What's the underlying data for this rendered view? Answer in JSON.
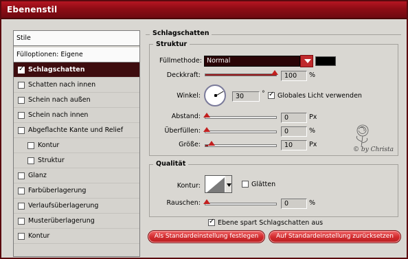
{
  "window": {
    "title": "Ebenenstil"
  },
  "left_list": {
    "items": [
      {
        "label": "Stile",
        "type": "header"
      },
      {
        "label": "Fülloptionen: Eigene",
        "type": "header"
      },
      {
        "label": "Schlagschatten",
        "checked": true,
        "selected": true
      },
      {
        "label": "Schatten nach innen",
        "checked": false
      },
      {
        "label": "Schein nach außen",
        "checked": false
      },
      {
        "label": "Schein nach innen",
        "checked": false
      },
      {
        "label": "Abgeflachte Kante und Relief",
        "checked": false
      },
      {
        "label": "Kontur",
        "checked": false,
        "indented": true
      },
      {
        "label": "Struktur",
        "checked": false,
        "indented": true
      },
      {
        "label": "Glanz",
        "checked": false
      },
      {
        "label": "Farbüberlagerung",
        "checked": false
      },
      {
        "label": "Verlaufsüberlagerung",
        "checked": false
      },
      {
        "label": "Musterüberlagerung",
        "checked": false
      },
      {
        "label": "Kontur",
        "checked": false
      }
    ]
  },
  "panel": {
    "title": "Schlagschatten",
    "structure": {
      "title": "Struktur",
      "blend_mode": {
        "label": "Füllmethode:",
        "value": "Normal",
        "color": "#000000"
      },
      "opacity": {
        "label": "Deckkraft:",
        "value": "100",
        "unit": "%",
        "fraction": 1.0
      },
      "angle": {
        "label": "Winkel:",
        "value": "30",
        "unit": "°",
        "degrees": 30
      },
      "global_light": {
        "label": "Globales Licht verwenden",
        "checked": true
      },
      "distance": {
        "label": "Abstand:",
        "value": "0",
        "unit": "Px",
        "fraction": 0.0
      },
      "spread": {
        "label": "Überfüllen:",
        "value": "0",
        "unit": "%",
        "fraction": 0.0
      },
      "size": {
        "label": "Größe:",
        "value": "10",
        "unit": "Px",
        "fraction": 0.04
      }
    },
    "quality": {
      "title": "Qualität",
      "contour": {
        "label": "Kontur:"
      },
      "antialias": {
        "label": "Glätten",
        "checked": false
      },
      "noise": {
        "label": "Rauschen:",
        "value": "0",
        "unit": "%",
        "fraction": 0.0
      }
    },
    "knockout": {
      "label": "Ebene spart Schlagschatten aus",
      "checked": true
    },
    "buttons": {
      "set_default": "Als Standardeinstellung festlegen",
      "reset_default": "Auf Standardeinstellung zurücksetzen"
    },
    "watermark": {
      "text": "© by Christa"
    }
  },
  "colors": {
    "accent": "#8e0c15",
    "selected_bg": "#3e0d0f",
    "button": "#d42d30"
  }
}
